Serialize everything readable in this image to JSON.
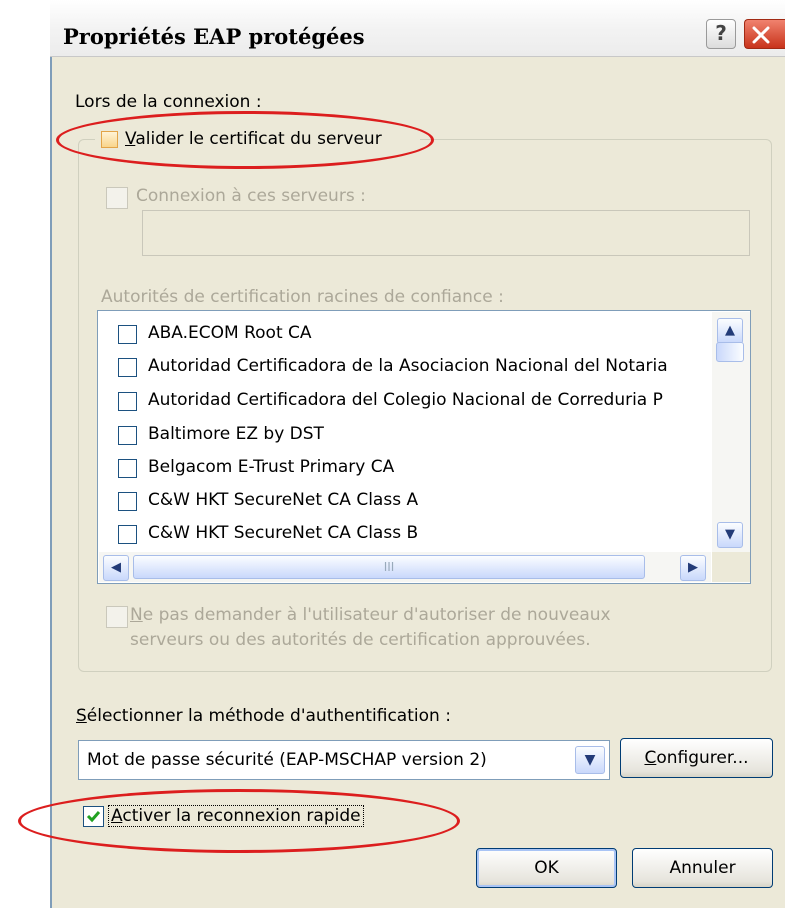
{
  "window": {
    "title": "Propriétés EAP protégées",
    "help_label": "?"
  },
  "connection": {
    "heading": "Lors de la connexion :",
    "validate_cert_label": "Valider le certificat du serveur",
    "validate_cert_checked": false,
    "connect_servers_label": "Connexion à ces serveurs :",
    "connect_servers_value": "",
    "ca_heading": "Autorités de certification racines de confiance :",
    "ca_items": [
      "ABA.ECOM Root CA",
      "Autoridad Certificadora de la Asociacion Nacional del Notaria",
      "Autoridad Certificadora del Colegio Nacional de Correduria P",
      "Baltimore EZ by DST",
      "Belgacom E-Trust Primary CA",
      "C&W HKT SecureNet CA Class A",
      "C&W HKT SecureNet CA Class B"
    ],
    "no_prompt_line1": "Ne pas demander à l'utilisateur d'autoriser de nouveaux",
    "no_prompt_line2": "serveurs ou des autorités de certification approuvées."
  },
  "auth": {
    "heading": "Sélectionner la méthode d'authentification :",
    "method_value": "Mot de passe sécurité (EAP-MSCHAP version 2)",
    "configure_label": "Configurer...",
    "fast_reconnect_label": "Activer la reconnexion rapide",
    "fast_reconnect_checked": true
  },
  "buttons": {
    "ok": "OK",
    "cancel": "Annuler"
  },
  "icons": {
    "scroll_up": "▲",
    "scroll_down": "▼",
    "scroll_left": "◀",
    "scroll_right": "▶",
    "grip": "III",
    "dropdown": "▼"
  },
  "colors": {
    "annotation": "#dc1e1e",
    "dialog_bg": "#ece9d8",
    "disabled_text": "#aca899"
  }
}
